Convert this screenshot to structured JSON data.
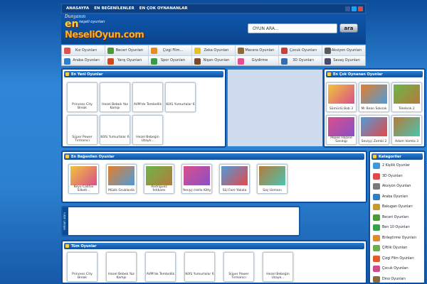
{
  "topnav": {
    "items": [
      "ANASAYFA",
      "EN BEĞENİLENLER",
      "EN ÇOK OYNANANLAR"
    ]
  },
  "logo": {
    "line1": "Dunyanın",
    "line2": "en",
    "line3": "neşeli oyunları",
    "line4": "NeseliOyun.com"
  },
  "search": {
    "placeholder": "OYUN ARA...",
    "value": "OYUN ARA...",
    "button": "ara"
  },
  "categories": [
    {
      "label": "Kız Oyunları",
      "color": "#d9534f"
    },
    {
      "label": "Beceri Oyunları",
      "color": "#4a9a3a"
    },
    {
      "label": "Çizgi Film...",
      "color": "#e58b2b"
    },
    {
      "label": "Zeka Oyunları",
      "color": "#e8c020"
    },
    {
      "label": "Macera Oyunları",
      "color": "#8e6a3a"
    },
    {
      "label": "Çocuk Oyunları",
      "color": "#c84040"
    },
    {
      "label": "Aksiyon Oyunları",
      "color": "#5a5a5a"
    },
    {
      "label": "Araba Oyunları",
      "color": "#2f7fc8"
    },
    {
      "label": "Yarış Oyunları",
      "color": "#d04a20"
    },
    {
      "label": "Spor Oyunları",
      "color": "#3a9a4a"
    },
    {
      "label": "Nişan Oyunları",
      "color": "#7a4a2a"
    },
    {
      "label": "Giydirme",
      "color": "#e05090"
    },
    {
      "label": "3D Oyunları",
      "color": "#3a6ab0"
    },
    {
      "label": "Savaş Oyunları",
      "color": "#4a4a6a"
    }
  ],
  "newest": {
    "title": "En Yeni Oyunlar",
    "games": [
      "Princess City Break",
      "Hezel Bebek Yaz Kampı",
      "AVM'de Tembellik",
      "Köfü Yumurtalar 6",
      "Süper Power Tırmanıcı",
      "Köfü Yumurtalar 6",
      "Hezel Bebeğin Uzayk..."
    ]
  },
  "most_played": {
    "title": "En Çok Oynanan Oyunlar",
    "games": [
      "Sümürlü Bob 3",
      "Mr Bean Soksak",
      "Telelenk 2",
      "Pepee Hazine Sandığı",
      "Sevişçi Zombi 2",
      "Adam Vomta 3"
    ]
  },
  "liked": {
    "title": "En Beğenilen Oyunlar",
    "games": [
      "Keyo Califox Silkelt...",
      "Müzik Grublarda",
      "Rodriguez İntikamı",
      "Yenışçı Hello Kitty",
      "Süi Fare Yakala",
      "Saç Uzmanı"
    ],
    "extra": "Sisi Fare Yakala"
  },
  "side_label": "reklam alanı",
  "all_games": {
    "title": "Tüm Oyunlar",
    "games": [
      "Princess City Break",
      "Hezel Bebek Yaz Kampı",
      "AVM'de Tembellik",
      "Köfü Yumurtalar 6",
      "Süper Power Tırmanıcı",
      "Hezel Bebeğin Uzayk..."
    ]
  },
  "sidebar": {
    "title": "Kategoriler",
    "items": [
      "2 Kişilik Oyunlar",
      "3D Oyunları",
      "Aksiyon Oyunları",
      "Araba Oyunları",
      "Bakugan Oyunları",
      "Beceri Oyunları",
      "Ben 10 Oyunları",
      "Birleştirme Oyunları",
      "Çiftlik Oyunları",
      "Çizgi Film Oyunları",
      "Çocuk Oyunları",
      "Dino Oyunları"
    ]
  }
}
